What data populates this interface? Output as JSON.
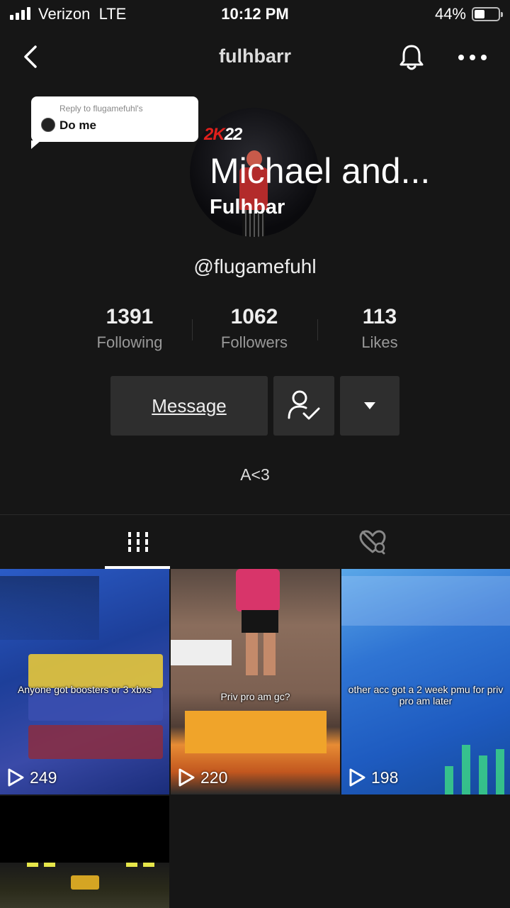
{
  "status_bar": {
    "carrier": "Verizon",
    "network": "LTE",
    "time": "10:12 PM",
    "battery_percent": "44%",
    "battery_level": 0.44
  },
  "nav": {
    "title": "fulhbarr",
    "icons": [
      "back-icon",
      "bell-icon",
      "more-icon"
    ]
  },
  "reply_sticker": {
    "label": "Reply to flugamefuhl's",
    "text": "Do me"
  },
  "avatar": {
    "logo_text_a": "2K",
    "logo_text_b": "22",
    "overlay_name": "Michael and...",
    "overlay_sub": "Fulhbar"
  },
  "profile": {
    "username": "@flugamefuhl",
    "bio": "A<3"
  },
  "stats": [
    {
      "value": "1391",
      "label": "Following"
    },
    {
      "value": "1062",
      "label": "Followers"
    },
    {
      "value": "113",
      "label": "Likes"
    }
  ],
  "actions": {
    "message_label": "Message",
    "follow_icon": "user-check-icon",
    "dropdown_icon": "caret-down-icon"
  },
  "tabs": [
    {
      "name": "videos",
      "icon": "grid-bars-icon",
      "active": true
    },
    {
      "name": "liked",
      "icon": "hidden-heart-icon",
      "active": false
    }
  ],
  "videos": [
    {
      "caption": "Anyone got boosters or 3 xbxs",
      "views": "249"
    },
    {
      "caption": "Priv pro am gc?",
      "views": "220"
    },
    {
      "caption": "other acc got a 2 week pmu for priv pro am later",
      "views": "198"
    },
    {
      "caption": "",
      "views": ""
    }
  ],
  "colors": {
    "background": "#161616",
    "button_bg": "#2e2e2e",
    "accent_red": "#e0201c"
  }
}
